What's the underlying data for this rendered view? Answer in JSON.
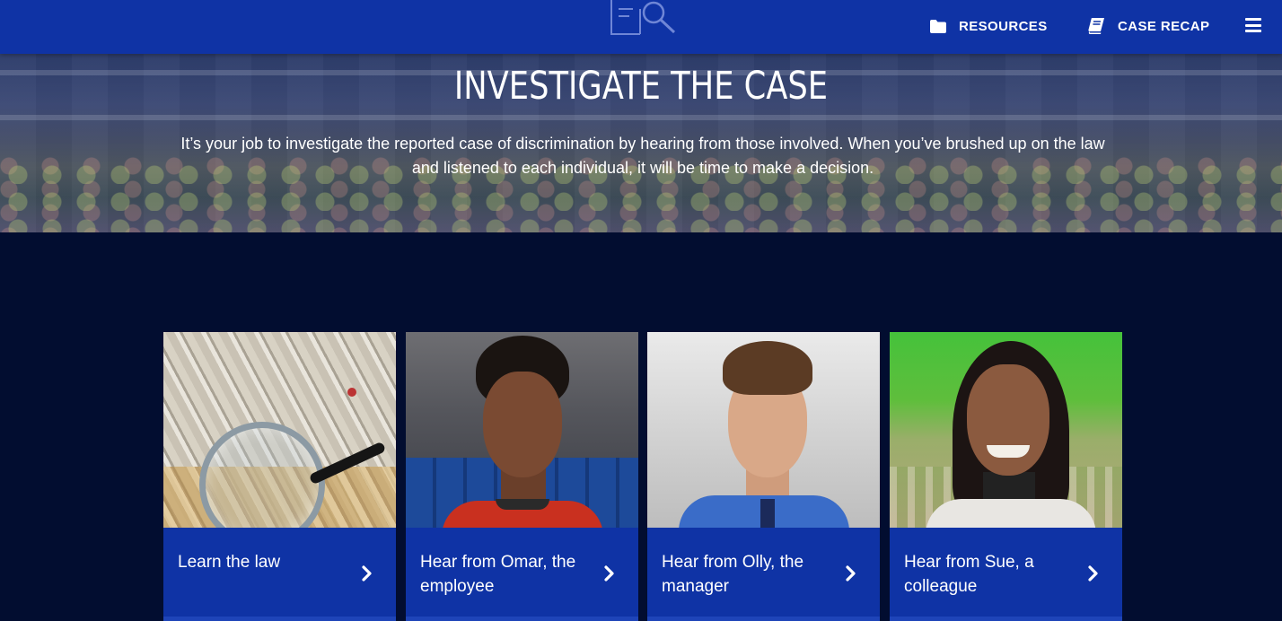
{
  "header": {
    "nav": [
      {
        "label": "RESOURCES",
        "icon": "folder-icon"
      },
      {
        "label": "CASE RECAP",
        "icon": "book-icon"
      }
    ],
    "menu_icon": "hamburger-menu-icon",
    "logo_icon": "document-magnifier-icon"
  },
  "hero": {
    "title": "INVESTIGATE THE CASE",
    "text": "It’s your job to investigate the reported case of discrimination by hearing from those involved. When you’ve brushed up on the law and listened to each individual, it will be time to make a decision."
  },
  "cards": [
    {
      "label": "Learn the law",
      "photo": "files-with-magnifying-glass",
      "icon": "chevron-right-icon"
    },
    {
      "label": "Hear from Omar, the employee",
      "photo": "omar-portrait",
      "icon": "chevron-right-icon"
    },
    {
      "label": "Hear from Olly, the manager",
      "photo": "olly-portrait",
      "icon": "chevron-right-icon"
    },
    {
      "label": "Hear from Sue, a colleague",
      "photo": "sue-portrait",
      "icon": "chevron-right-icon"
    }
  ],
  "colors": {
    "header_blue": "#0f33a5",
    "page_background": "#020d30",
    "text": "#ffffff"
  }
}
